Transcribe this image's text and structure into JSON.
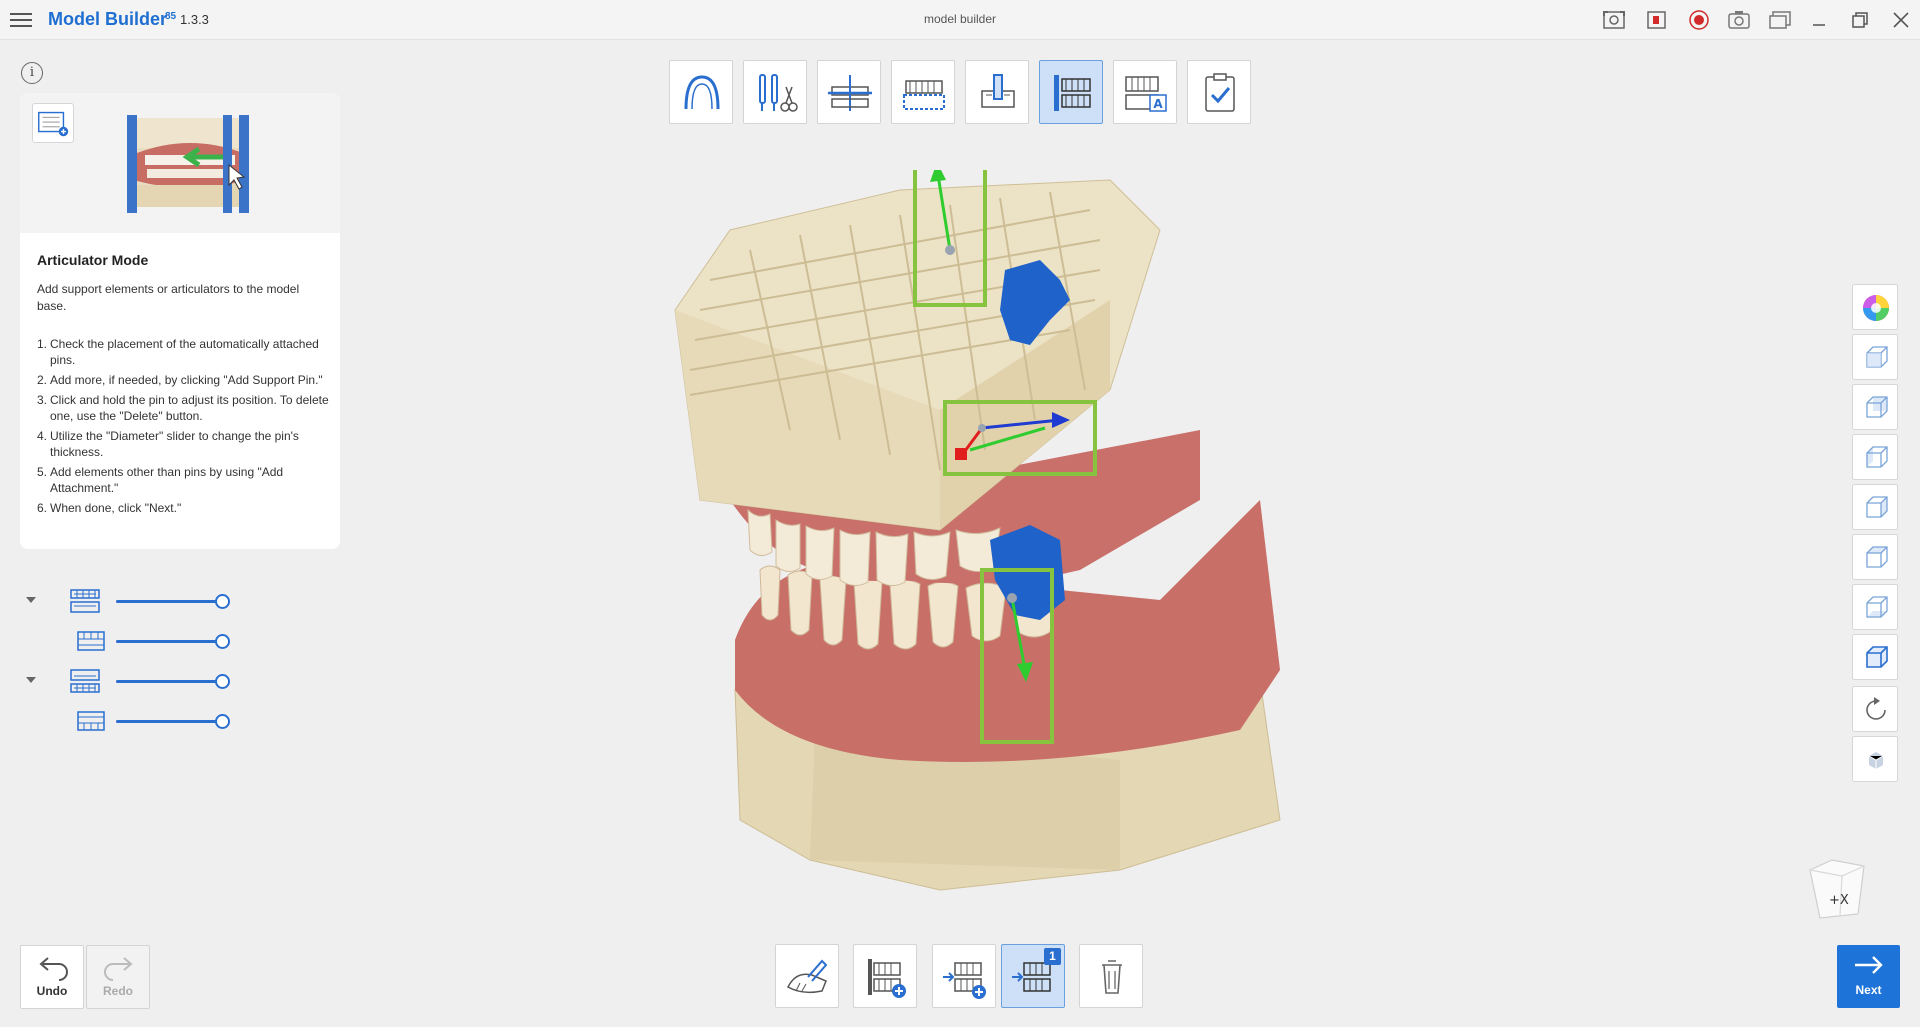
{
  "titlebar": {
    "app_name": "Model Builder",
    "app_badge": "85",
    "version": "1.3.3",
    "window_title": "model builder",
    "icons": [
      "capture-region-icon",
      "record-region-icon",
      "record-icon",
      "camera-icon",
      "window-capture-icon"
    ],
    "window_controls": [
      "minimize-icon",
      "restore-icon",
      "close-icon"
    ]
  },
  "help": {
    "title": "Articulator Mode",
    "intro": "Add support elements or articulators to the model base.",
    "steps": [
      {
        "num": "1.",
        "text": "Check the placement of the automatically attached pins."
      },
      {
        "num": "2.",
        "text": "Add more, if needed, by clicking \"Add Support Pin.\""
      },
      {
        "num": "3.",
        "text": "Click and hold the pin to adjust its position. To delete one, use the \"Delete\" button."
      },
      {
        "num": "4.",
        "text": "Utilize the \"Diameter\" slider to change the pin's thickness."
      },
      {
        "num": "5.",
        "text": "Add elements other than pins by using \"Add Attachment.\""
      },
      {
        "num": "6.",
        "text": "When done, click \"Next.\""
      }
    ]
  },
  "layers": [
    {
      "name": "upper-model-group",
      "level": 1.0
    },
    {
      "name": "upper-model",
      "level": 1.0
    },
    {
      "name": "lower-model-group",
      "level": 1.0
    },
    {
      "name": "lower-model",
      "level": 1.0
    }
  ],
  "toolbar": {
    "steps": [
      "arch-icon",
      "trim-tools-icon",
      "occlusal-plane-icon",
      "model-base-icon",
      "die-icon",
      "articulator-icon",
      "text-label-icon",
      "review-check-icon"
    ],
    "active_step": "articulator-icon"
  },
  "side_tools": [
    "color-wheel-icon",
    "front-view-icon",
    "back-view-icon",
    "left-view-icon",
    "right-view-icon",
    "top-view-icon",
    "bottom-view-icon",
    "iso-view-icon",
    "rotate-icon",
    "solid-view-icon"
  ],
  "bottom": {
    "undo_label": "Undo",
    "redo_label": "Redo",
    "next_label": "Next",
    "tools": [
      "pin-edit-icon",
      "add-support-pin-icon",
      "add-attachment-icon",
      "attachment-list-icon",
      "delete-icon"
    ],
    "attachment_count": "1"
  },
  "view_cube": {
    "label": "+X"
  },
  "colors": {
    "accent": "#1e73d8",
    "stone": "#e6d9b6",
    "gum": "#c96d66",
    "pin": "#1f62c9",
    "gizmo_box": "#86c440"
  }
}
